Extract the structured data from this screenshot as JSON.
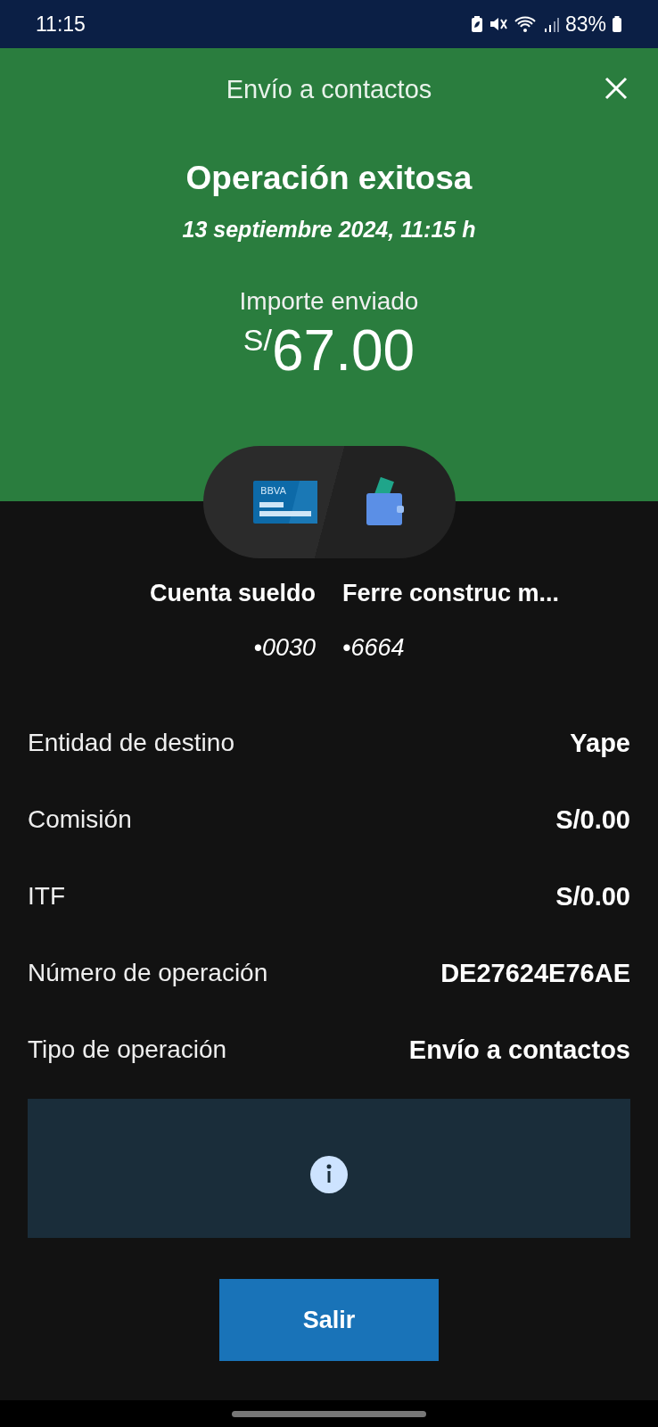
{
  "status_bar": {
    "time": "11:15",
    "battery": "83%"
  },
  "header": {
    "title": "Envío a contactos"
  },
  "result": {
    "title": "Operación exitosa",
    "date": "13 septiembre 2024, 11:15 h",
    "amount_label": "Importe enviado",
    "currency": "S/",
    "amount": "67.00"
  },
  "transfer": {
    "card_logo": "BBVA",
    "from": {
      "name": "Cuenta sueldo",
      "number": "•0030"
    },
    "to": {
      "name": "Ferre construc m...",
      "number": "•6664"
    }
  },
  "details": [
    {
      "label": "Entidad de destino",
      "value": "Yape"
    },
    {
      "label": "Comisión",
      "value": "S/0.00"
    },
    {
      "label": "ITF",
      "value": "S/0.00"
    },
    {
      "label": "Número de operación",
      "value": "DE27624E76AE"
    },
    {
      "label": "Tipo de operación",
      "value": "Envío a contactos"
    }
  ],
  "button": "Salir"
}
